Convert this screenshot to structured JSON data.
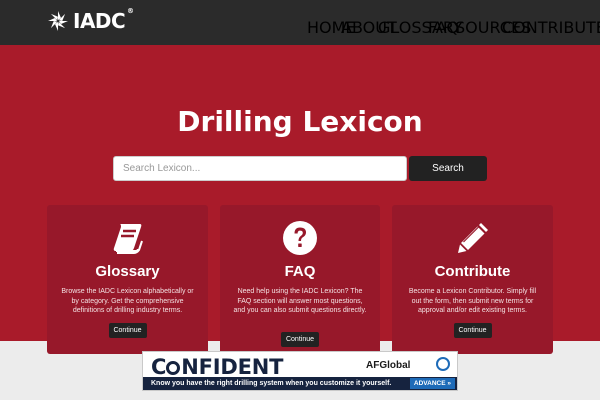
{
  "brand": {
    "name": "IADC",
    "trademark": "®"
  },
  "nav": {
    "items": [
      {
        "label": "HOME"
      },
      {
        "label": "ABOUT"
      },
      {
        "label": "GLOSSARY"
      },
      {
        "label": "FAQ"
      },
      {
        "label": "SOURCES"
      },
      {
        "label": "CONTRIBUTE"
      }
    ]
  },
  "hero": {
    "title": "Drilling Lexicon",
    "search_placeholder": "Search Lexicon...",
    "search_button": "Search"
  },
  "cards": [
    {
      "icon": "book-icon",
      "title": "Glossary",
      "text": "Browse the IADC Lexicon alphabetically or by category. Get the comprehensive definitions of drilling industry terms.",
      "button": "Continue"
    },
    {
      "icon": "question-circle-icon",
      "title": "FAQ",
      "text": "Need help using the IADC Lexicon? The FAQ section will answer most questions, and you can also submit questions directly.",
      "button": "Continue"
    },
    {
      "icon": "pencil-icon",
      "title": "Contribute",
      "text": "Become a Lexicon Contributor. Simply fill out the form, then submit new terms for approval and/or edit existing terms.",
      "button": "Continue"
    }
  ],
  "ad": {
    "headline_start": "C",
    "headline_end": "NFIDENT",
    "brand": "AFGlobal",
    "tagline": "Know you have the right drilling system when you customize it yourself.",
    "cta": "ADVANCE »"
  },
  "colors": {
    "navbar": "#2b2b2b",
    "hero": "#a91b2a",
    "card": "#97182a",
    "button": "#222222",
    "ad_navy": "#16233f",
    "ad_blue": "#1e6bb8"
  }
}
